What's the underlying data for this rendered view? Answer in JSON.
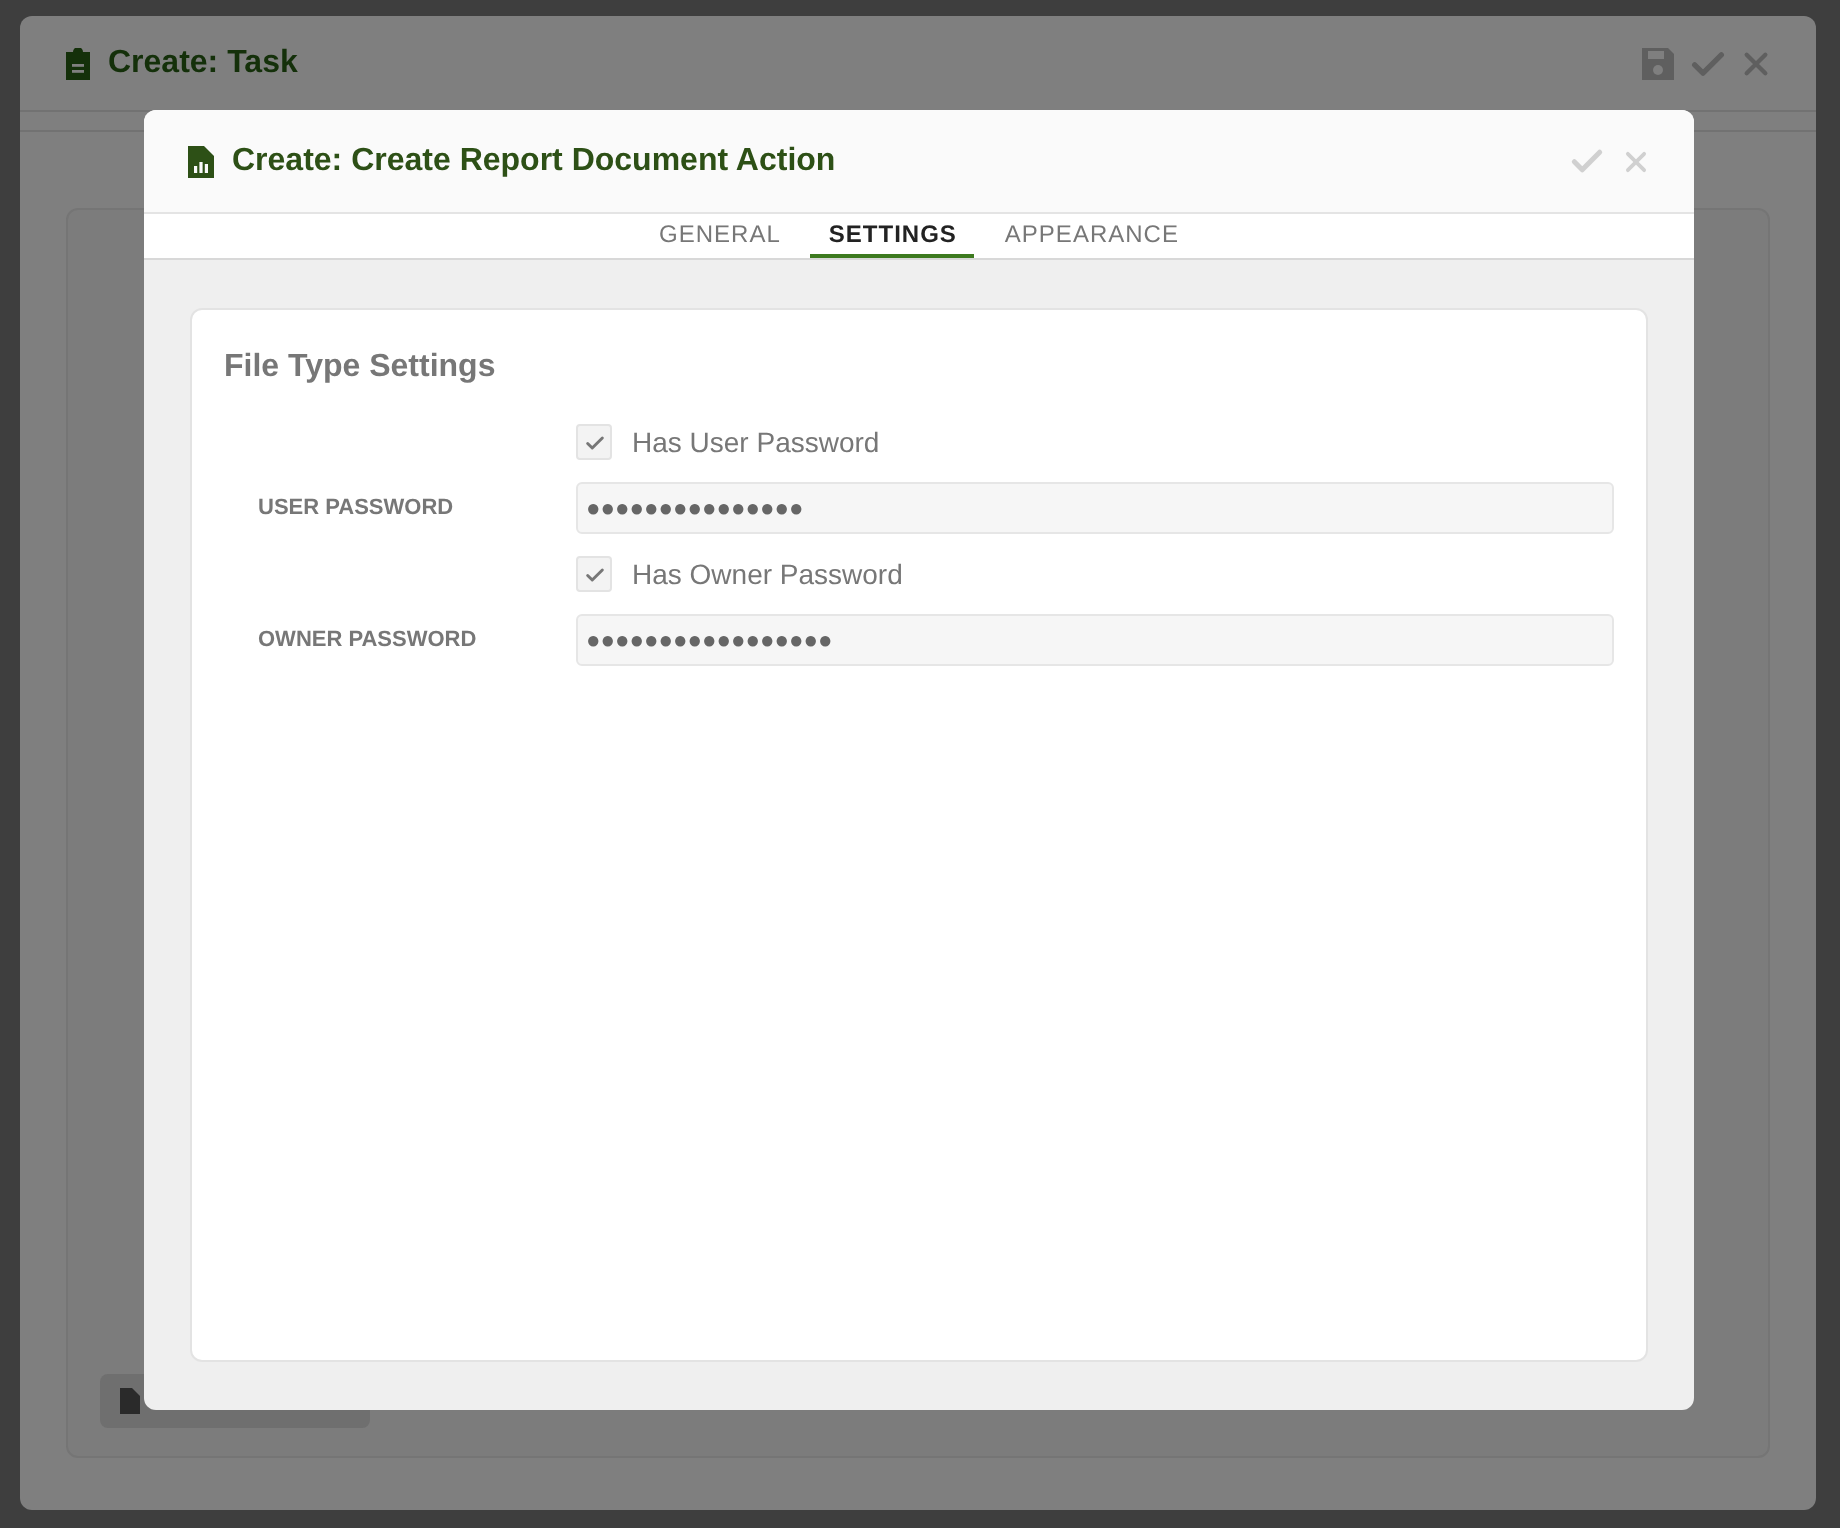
{
  "background_window": {
    "title": "Create: Task"
  },
  "dialog": {
    "title": "Create: Create Report Document Action",
    "tabs": [
      {
        "label": "GENERAL",
        "selected": false
      },
      {
        "label": "SETTINGS",
        "selected": true
      },
      {
        "label": "APPEARANCE",
        "selected": false
      }
    ],
    "section": {
      "title": "File Type Settings",
      "rows": [
        {
          "kind": "checkbox",
          "label": "Has User Password",
          "checked": true
        },
        {
          "kind": "password",
          "label": "USER PASSWORD",
          "value": "●●●●●●●●●●●●●●●"
        },
        {
          "kind": "checkbox",
          "label": "Has Owner Password",
          "checked": true
        },
        {
          "kind": "password",
          "label": "OWNER PASSWORD",
          "value": "●●●●●●●●●●●●●●●●●"
        }
      ]
    }
  }
}
